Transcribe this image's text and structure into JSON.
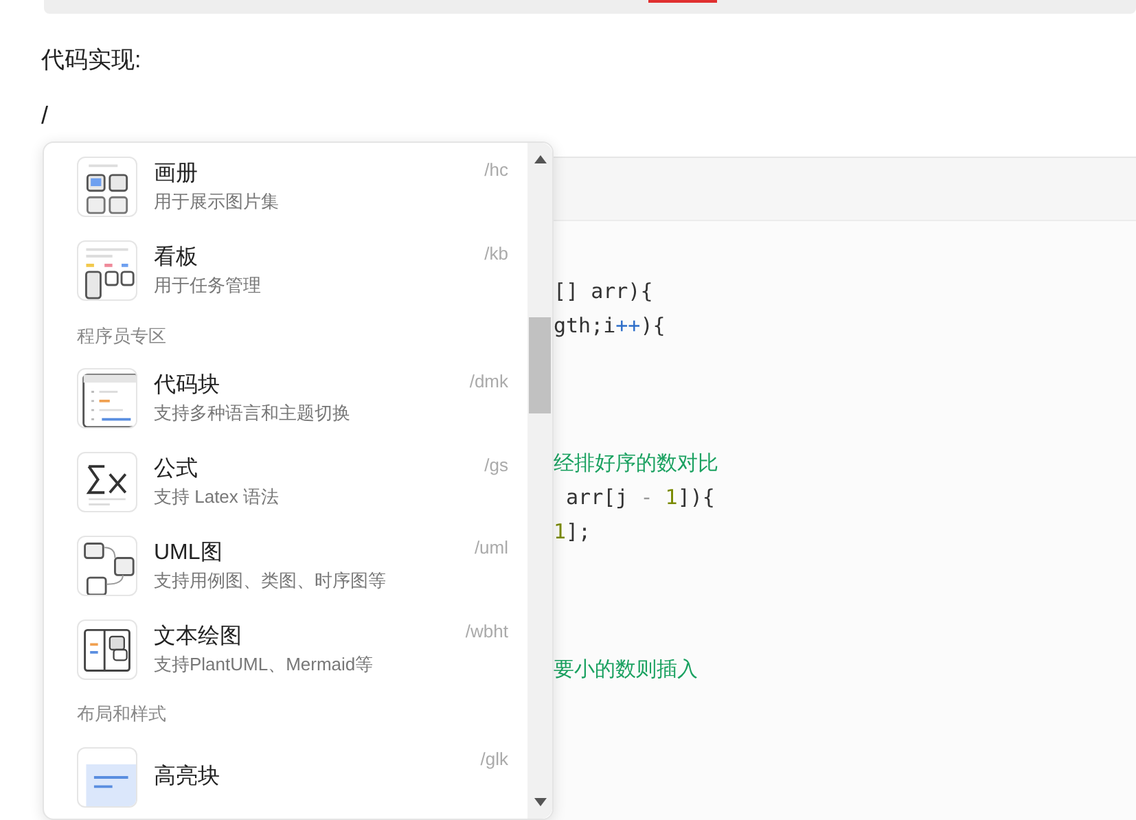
{
  "heading": "代码实现:",
  "typed": "/",
  "menu": {
    "entries": [
      {
        "kind": "item",
        "title": "画册",
        "desc": "用于展示图片集",
        "shortcut": "/hc"
      },
      {
        "kind": "item",
        "title": "看板",
        "desc": "用于任务管理",
        "shortcut": "/kb"
      },
      {
        "kind": "header",
        "title": "程序员专区"
      },
      {
        "kind": "item",
        "title": "代码块",
        "desc": "支持多种语言和主题切换",
        "shortcut": "/dmk"
      },
      {
        "kind": "item",
        "title": "公式",
        "desc": "支持 Latex 语法",
        "shortcut": "/gs"
      },
      {
        "kind": "item",
        "title": "UML图",
        "desc": "支持用例图、类图、时序图等",
        "shortcut": "/uml"
      },
      {
        "kind": "item",
        "title": "文本绘图",
        "desc": "支持PlantUML、Mermaid等",
        "shortcut": "/wbht"
      },
      {
        "kind": "header",
        "title": "布局和样式"
      },
      {
        "kind": "item",
        "title": "高亮块",
        "shortcut": "/glk"
      }
    ]
  },
  "code_lines": [
    [
      {
        "kind": "plain",
        "text": "[] arr){"
      }
    ],
    [
      {
        "kind": "plain",
        "text": "gth;i"
      },
      {
        "kind": "op",
        "text": "++"
      },
      {
        "kind": "plain",
        "text": "){"
      }
    ],
    [
      {
        "kind": "comment",
        "text": "经排好序的数对比"
      }
    ],
    [
      {
        "kind": "plain",
        "text": " arr[j "
      },
      {
        "kind": "minus",
        "text": "- "
      },
      {
        "kind": "num",
        "text": "1"
      },
      {
        "kind": "plain",
        "text": "]){"
      }
    ],
    [
      {
        "kind": "num",
        "text": "1"
      },
      {
        "kind": "plain",
        "text": "];"
      }
    ],
    [
      {
        "kind": "comment",
        "text": "要小的数则插入"
      }
    ]
  ]
}
